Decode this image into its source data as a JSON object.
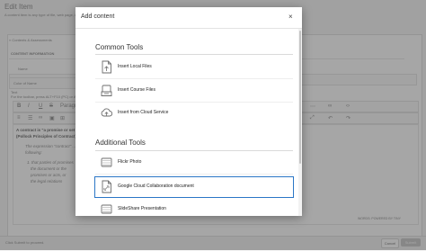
{
  "background": {
    "title": "Edit Item",
    "subtitle": "A content item is any type of file, web page, or other object.",
    "breadcrumb": "« Contents & Assessments",
    "section_label": "CONTENT INFORMATION",
    "name_label": "Name",
    "color_label": "Color of Name",
    "text_label": "Text",
    "text_hint": "For the toolbar, press ALT+F10 (PC) or ALT+FN+F10 (Mac).",
    "paragraph_label": "Paragraph",
    "body_lines": [
      "A contract is \"a promise or set of promises for the breach of which the law gives a remedy\"",
      "(Pollock Principles of Contract)",
      "The expression \"contract\" ... the following:",
      "following:",
      "1. that parties of promises",
      "the document or the",
      "promises or acts, or",
      "the legal relations"
    ],
    "word_count": "WORDS: POWERED BY TINY",
    "footer_hint": "Click Submit to proceed.",
    "cancel_label": "Cancel",
    "submit_label": "Submit"
  },
  "modal": {
    "title": "Add content",
    "close_glyph": "×",
    "sections": [
      {
        "heading": "Common Tools",
        "tools": [
          {
            "label": "Insert Local Files",
            "icon": "file-icon",
            "highlighted": false
          },
          {
            "label": "Insert Course Files",
            "icon": "course-files-icon",
            "highlighted": false
          },
          {
            "label": "Insert from Cloud Service",
            "icon": "cloud-upload-icon",
            "highlighted": false
          }
        ]
      },
      {
        "heading": "Additional Tools",
        "tools": [
          {
            "label": "Flickr Photo",
            "icon": "flickr-photo-icon",
            "highlighted": false
          },
          {
            "label": "Google Cloud Collaboration document",
            "icon": "document-link-icon",
            "highlighted": true
          },
          {
            "label": "SlideShare Presentation",
            "icon": "slideshare-icon",
            "highlighted": false
          }
        ]
      }
    ]
  },
  "colors": {
    "highlight": "#2a76c6",
    "overlay": "rgba(0,0,0,0.35)",
    "submit": "#cfcfcf"
  }
}
